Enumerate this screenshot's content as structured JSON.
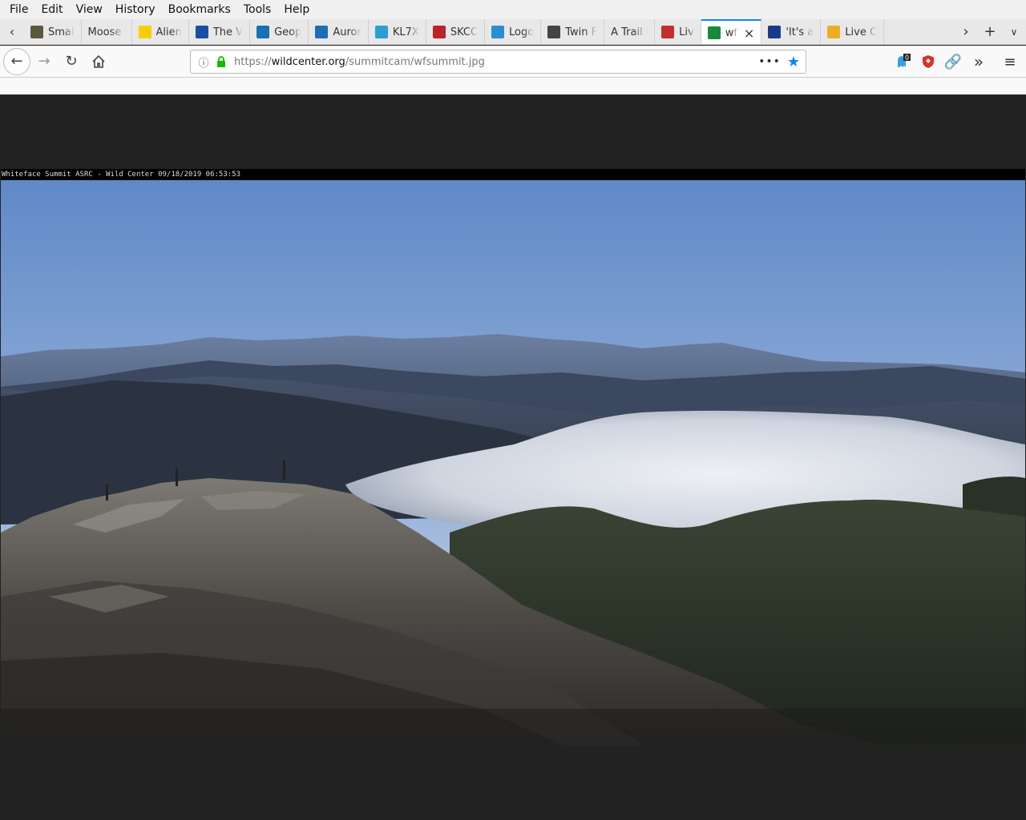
{
  "menubar": {
    "items": [
      {
        "id": "file",
        "label": "File"
      },
      {
        "id": "edit",
        "label": "Edit"
      },
      {
        "id": "view",
        "label": "View"
      },
      {
        "id": "history",
        "label": "History"
      },
      {
        "id": "bookmarks",
        "label": "Bookmarks"
      },
      {
        "id": "tools",
        "label": "Tools"
      },
      {
        "id": "help",
        "label": "Help"
      }
    ]
  },
  "tabs": [
    {
      "label": "Smal",
      "icon": "image-icon",
      "color": "#5a5a3a"
    },
    {
      "label": "Moose R",
      "icon": "none",
      "color": ""
    },
    {
      "label": "Alien",
      "icon": "radiation-icon",
      "color": "#f5d000"
    },
    {
      "label": "The V",
      "icon": "w3-icon",
      "color": "#1a4fa0"
    },
    {
      "label": "Geop",
      "icon": "noaa-icon",
      "color": "#1a6fb5"
    },
    {
      "label": "Auror",
      "icon": "noaa-icon",
      "color": "#1a6fb5"
    },
    {
      "label": "KL7X",
      "icon": "globe-icon",
      "color": "#2a9fd0"
    },
    {
      "label": "SKCC",
      "icon": "skcc-icon",
      "color": "#c0202a"
    },
    {
      "label": "Logo",
      "icon": "edge-icon",
      "color": "#2a8fd0"
    },
    {
      "label": "Twin F",
      "icon": "grid-icon",
      "color": "#444444"
    },
    {
      "label": "A Trail to",
      "icon": "none",
      "color": ""
    },
    {
      "label": "Liv",
      "icon": "live-icon",
      "color": "#c03030"
    },
    {
      "label": "wf",
      "icon": "wildcenter-icon",
      "color": "#1a8a3a",
      "active": true
    },
    {
      "label": "'It's a",
      "icon": "circle-icon",
      "color": "#1a3a8a"
    },
    {
      "label": "Live C",
      "icon": "shield-icon",
      "color": "#e8b020"
    }
  ],
  "urlbar": {
    "scheme": "https://",
    "host": "wildcenter.org",
    "path": "/summitcam/wfsummit.jpg"
  },
  "extensions": {
    "badge_count": "0"
  },
  "image": {
    "timestamp_caption": "Whiteface Summit ASRC - Wild Center 09/18/2019 06:53:53"
  }
}
